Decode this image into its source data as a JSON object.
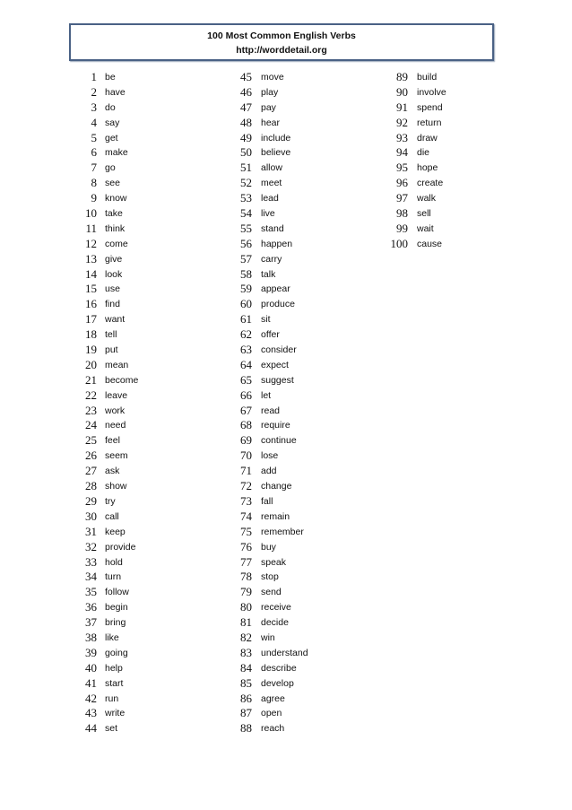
{
  "header": {
    "title": "100 Most Common English Verbs",
    "url": "http://worddetail.org"
  },
  "columns": [
    [
      {
        "n": "1",
        "w": "be"
      },
      {
        "n": "2",
        "w": "have"
      },
      {
        "n": "3",
        "w": "do"
      },
      {
        "n": "4",
        "w": "say"
      },
      {
        "n": "5",
        "w": "get"
      },
      {
        "n": "6",
        "w": "make"
      },
      {
        "n": "7",
        "w": "go"
      },
      {
        "n": "8",
        "w": "see"
      },
      {
        "n": "9",
        "w": "know"
      },
      {
        "n": "10",
        "w": "take"
      },
      {
        "n": "11",
        "w": "think"
      },
      {
        "n": "12",
        "w": "come"
      },
      {
        "n": "13",
        "w": "give"
      },
      {
        "n": "14",
        "w": "look"
      },
      {
        "n": "15",
        "w": "use"
      },
      {
        "n": "16",
        "w": "find"
      },
      {
        "n": "17",
        "w": "want"
      },
      {
        "n": "18",
        "w": "tell"
      },
      {
        "n": "19",
        "w": "put"
      },
      {
        "n": "20",
        "w": "mean"
      },
      {
        "n": "21",
        "w": "become"
      },
      {
        "n": "22",
        "w": "leave"
      },
      {
        "n": "23",
        "w": "work"
      },
      {
        "n": "24",
        "w": "need"
      },
      {
        "n": "25",
        "w": "feel"
      },
      {
        "n": "26",
        "w": "seem"
      },
      {
        "n": "27",
        "w": "ask"
      },
      {
        "n": "28",
        "w": "show"
      },
      {
        "n": "29",
        "w": "try"
      },
      {
        "n": "30",
        "w": "call"
      },
      {
        "n": "31",
        "w": "keep"
      },
      {
        "n": "32",
        "w": "provide"
      },
      {
        "n": "33",
        "w": "hold"
      },
      {
        "n": "34",
        "w": "turn"
      },
      {
        "n": "35",
        "w": "follow"
      },
      {
        "n": "36",
        "w": "begin"
      },
      {
        "n": "37",
        "w": "bring"
      },
      {
        "n": "38",
        "w": "like"
      },
      {
        "n": "39",
        "w": "going"
      },
      {
        "n": "40",
        "w": "help"
      },
      {
        "n": "41",
        "w": "start"
      },
      {
        "n": "42",
        "w": "run"
      },
      {
        "n": "43",
        "w": "write"
      },
      {
        "n": "44",
        "w": "set"
      }
    ],
    [
      {
        "n": "45",
        "w": "move"
      },
      {
        "n": "46",
        "w": "play"
      },
      {
        "n": "47",
        "w": "pay"
      },
      {
        "n": "48",
        "w": "hear"
      },
      {
        "n": "49",
        "w": "include"
      },
      {
        "n": "50",
        "w": "believe"
      },
      {
        "n": "51",
        "w": "allow"
      },
      {
        "n": "52",
        "w": "meet"
      },
      {
        "n": "53",
        "w": "lead"
      },
      {
        "n": "54",
        "w": "live"
      },
      {
        "n": "55",
        "w": "stand"
      },
      {
        "n": "56",
        "w": "happen"
      },
      {
        "n": "57",
        "w": "carry"
      },
      {
        "n": "58",
        "w": "talk"
      },
      {
        "n": "59",
        "w": "appear"
      },
      {
        "n": "60",
        "w": "produce"
      },
      {
        "n": "61",
        "w": "sit"
      },
      {
        "n": "62",
        "w": "offer"
      },
      {
        "n": "63",
        "w": "consider"
      },
      {
        "n": "64",
        "w": "expect"
      },
      {
        "n": "65",
        "w": "suggest"
      },
      {
        "n": "66",
        "w": "let"
      },
      {
        "n": "67",
        "w": "read"
      },
      {
        "n": "68",
        "w": "require"
      },
      {
        "n": "69",
        "w": "continue"
      },
      {
        "n": "70",
        "w": "lose"
      },
      {
        "n": "71",
        "w": "add"
      },
      {
        "n": "72",
        "w": "change"
      },
      {
        "n": "73",
        "w": "fall"
      },
      {
        "n": "74",
        "w": "remain"
      },
      {
        "n": "75",
        "w": "remember"
      },
      {
        "n": "76",
        "w": "buy"
      },
      {
        "n": "77",
        "w": "speak"
      },
      {
        "n": "78",
        "w": "stop"
      },
      {
        "n": "79",
        "w": "send"
      },
      {
        "n": "80",
        "w": "receive"
      },
      {
        "n": "81",
        "w": "decide"
      },
      {
        "n": "82",
        "w": "win"
      },
      {
        "n": "83",
        "w": "understand"
      },
      {
        "n": "84",
        "w": "describe"
      },
      {
        "n": "85",
        "w": "develop"
      },
      {
        "n": "86",
        "w": "agree"
      },
      {
        "n": "87",
        "w": "open"
      },
      {
        "n": "88",
        "w": "reach"
      }
    ],
    [
      {
        "n": "89",
        "w": "build"
      },
      {
        "n": "90",
        "w": "involve"
      },
      {
        "n": "91",
        "w": "spend"
      },
      {
        "n": "92",
        "w": "return"
      },
      {
        "n": "93",
        "w": "draw"
      },
      {
        "n": "94",
        "w": "die"
      },
      {
        "n": "95",
        "w": "hope"
      },
      {
        "n": "96",
        "w": "create"
      },
      {
        "n": "97",
        "w": "walk"
      },
      {
        "n": "98",
        "w": "sell"
      },
      {
        "n": "99",
        "w": "wait"
      },
      {
        "n": "100",
        "w": "cause"
      }
    ]
  ]
}
